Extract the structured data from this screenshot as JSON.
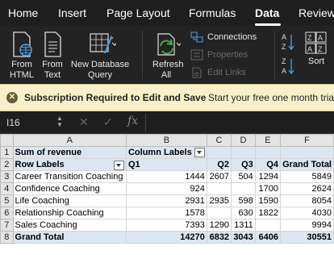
{
  "ribbon_tabs": [
    "Home",
    "Insert",
    "Page Layout",
    "Formulas",
    "Data",
    "Review"
  ],
  "ribbon": {
    "from_html": "From HTML",
    "from_text": "From Text",
    "new_db_query": "New Database Query",
    "refresh_all": "Refresh All",
    "connections": "Connections",
    "properties": "Properties",
    "edit_links": "Edit Links",
    "sort": "Sort"
  },
  "notice": {
    "title": "Subscription Required to Edit and Save",
    "message": "Start your free one month trial"
  },
  "formula_bar": {
    "name_box": "I16",
    "fx": "fx",
    "formula": ""
  },
  "sheet": {
    "columns": [
      "A",
      "B",
      "C",
      "D",
      "E",
      "F"
    ],
    "rows": [
      {
        "n": "1",
        "a": "Sum of revenue",
        "b": "Column Labels",
        "c": "",
        "d": "",
        "e": "",
        "f": ""
      },
      {
        "n": "2",
        "a": "Row Labels",
        "b": "Q1",
        "c": "Q2",
        "d": "Q3",
        "e": "Q4",
        "f": "Grand Total"
      },
      {
        "n": "3",
        "a": "Career Transition Coaching",
        "b": "1444",
        "c": "2607",
        "d": "504",
        "e": "1294",
        "f": "5849"
      },
      {
        "n": "4",
        "a": "Confidence Coaching",
        "b": "924",
        "c": "",
        "d": "",
        "e": "1700",
        "f": "2624"
      },
      {
        "n": "5",
        "a": "Life Coaching",
        "b": "2931",
        "c": "2935",
        "d": "598",
        "e": "1590",
        "f": "8054"
      },
      {
        "n": "6",
        "a": "Relationship Coaching",
        "b": "1578",
        "c": "",
        "d": "630",
        "e": "1822",
        "f": "4030"
      },
      {
        "n": "7",
        "a": "Sales Coaching",
        "b": "7393",
        "c": "1290",
        "d": "1311",
        "e": "",
        "f": "9994"
      },
      {
        "n": "8",
        "a": "Grand Total",
        "b": "14270",
        "c": "6832",
        "d": "3043",
        "e": "6406",
        "f": "30551"
      }
    ]
  }
}
